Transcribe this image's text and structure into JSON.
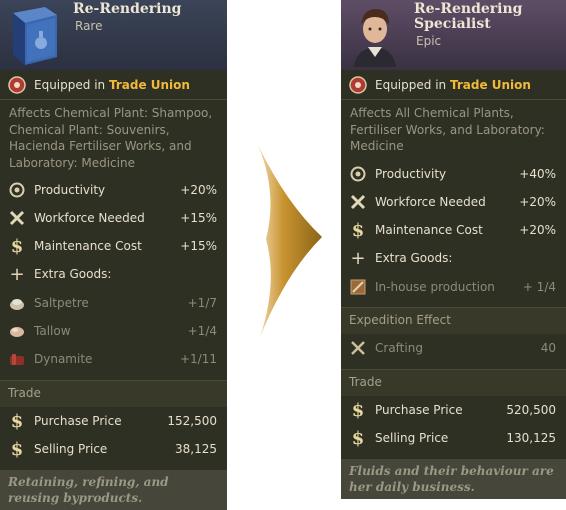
{
  "left": {
    "title": "Re-Rendering",
    "rarity": "Rare",
    "equipped_prefix": "Equipped in",
    "equipped_org": "Trade Union",
    "description": "Affects Chemical Plant: Shampoo, Chemical Plant: Souvenirs, Hacienda Fertiliser Works, and Laboratory: Medicine",
    "effects": [
      {
        "icon": "gear-icon",
        "label": "Productivity",
        "value": "+20%"
      },
      {
        "icon": "tools-icon",
        "label": "Workforce Needed",
        "value": "+15%"
      },
      {
        "icon": "dollar-icon",
        "label": "Maintenance Cost",
        "value": "+15%"
      }
    ],
    "extra_goods_label": "Extra Goods:",
    "extra_goods": [
      {
        "icon": "saltpetre-icon",
        "label": "Saltpetre",
        "value": "+1/7"
      },
      {
        "icon": "tallow-icon",
        "label": "Tallow",
        "value": "+1/4"
      },
      {
        "icon": "dynamite-icon",
        "label": "Dynamite",
        "value": "+1/11"
      }
    ],
    "trade_label": "Trade",
    "purchase_label": "Purchase Price",
    "purchase_value": "152,500",
    "selling_label": "Selling Price",
    "selling_value": "38,125",
    "flavor": "Retaining, refining, and reusing byproducts."
  },
  "right": {
    "title": "Re-Rendering Specialist",
    "rarity": "Epic",
    "equipped_prefix": "Equipped in",
    "equipped_org": "Trade Union",
    "description": "Affects All Chemical Plants, Fertiliser Works, and Laboratory: Medicine",
    "effects": [
      {
        "icon": "gear-icon",
        "label": "Productivity",
        "value": "+40%"
      },
      {
        "icon": "tools-icon",
        "label": "Workforce Needed",
        "value": "+20%"
      },
      {
        "icon": "dollar-icon",
        "label": "Maintenance Cost",
        "value": "+20%"
      }
    ],
    "extra_goods_label": "Extra Goods:",
    "extra_goods": [
      {
        "icon": "inhouse-production-icon",
        "label": "In-house production",
        "value": "+ 1/4"
      }
    ],
    "expedition_label": "Expedition Effect",
    "expedition_effect": {
      "icon": "crafting-icon",
      "label": "Crafting",
      "value": "40"
    },
    "trade_label": "Trade",
    "purchase_label": "Purchase Price",
    "purchase_value": "520,500",
    "selling_label": "Selling Price",
    "selling_value": "130,125",
    "flavor": "Fluids and their behaviour are her daily business."
  },
  "colors": {
    "card_bg": "#2f3024",
    "highlight": "#f0b93a",
    "arrow": "#8a6418",
    "rare_header": "#3b4458",
    "epic_header": "#5e4d66"
  }
}
